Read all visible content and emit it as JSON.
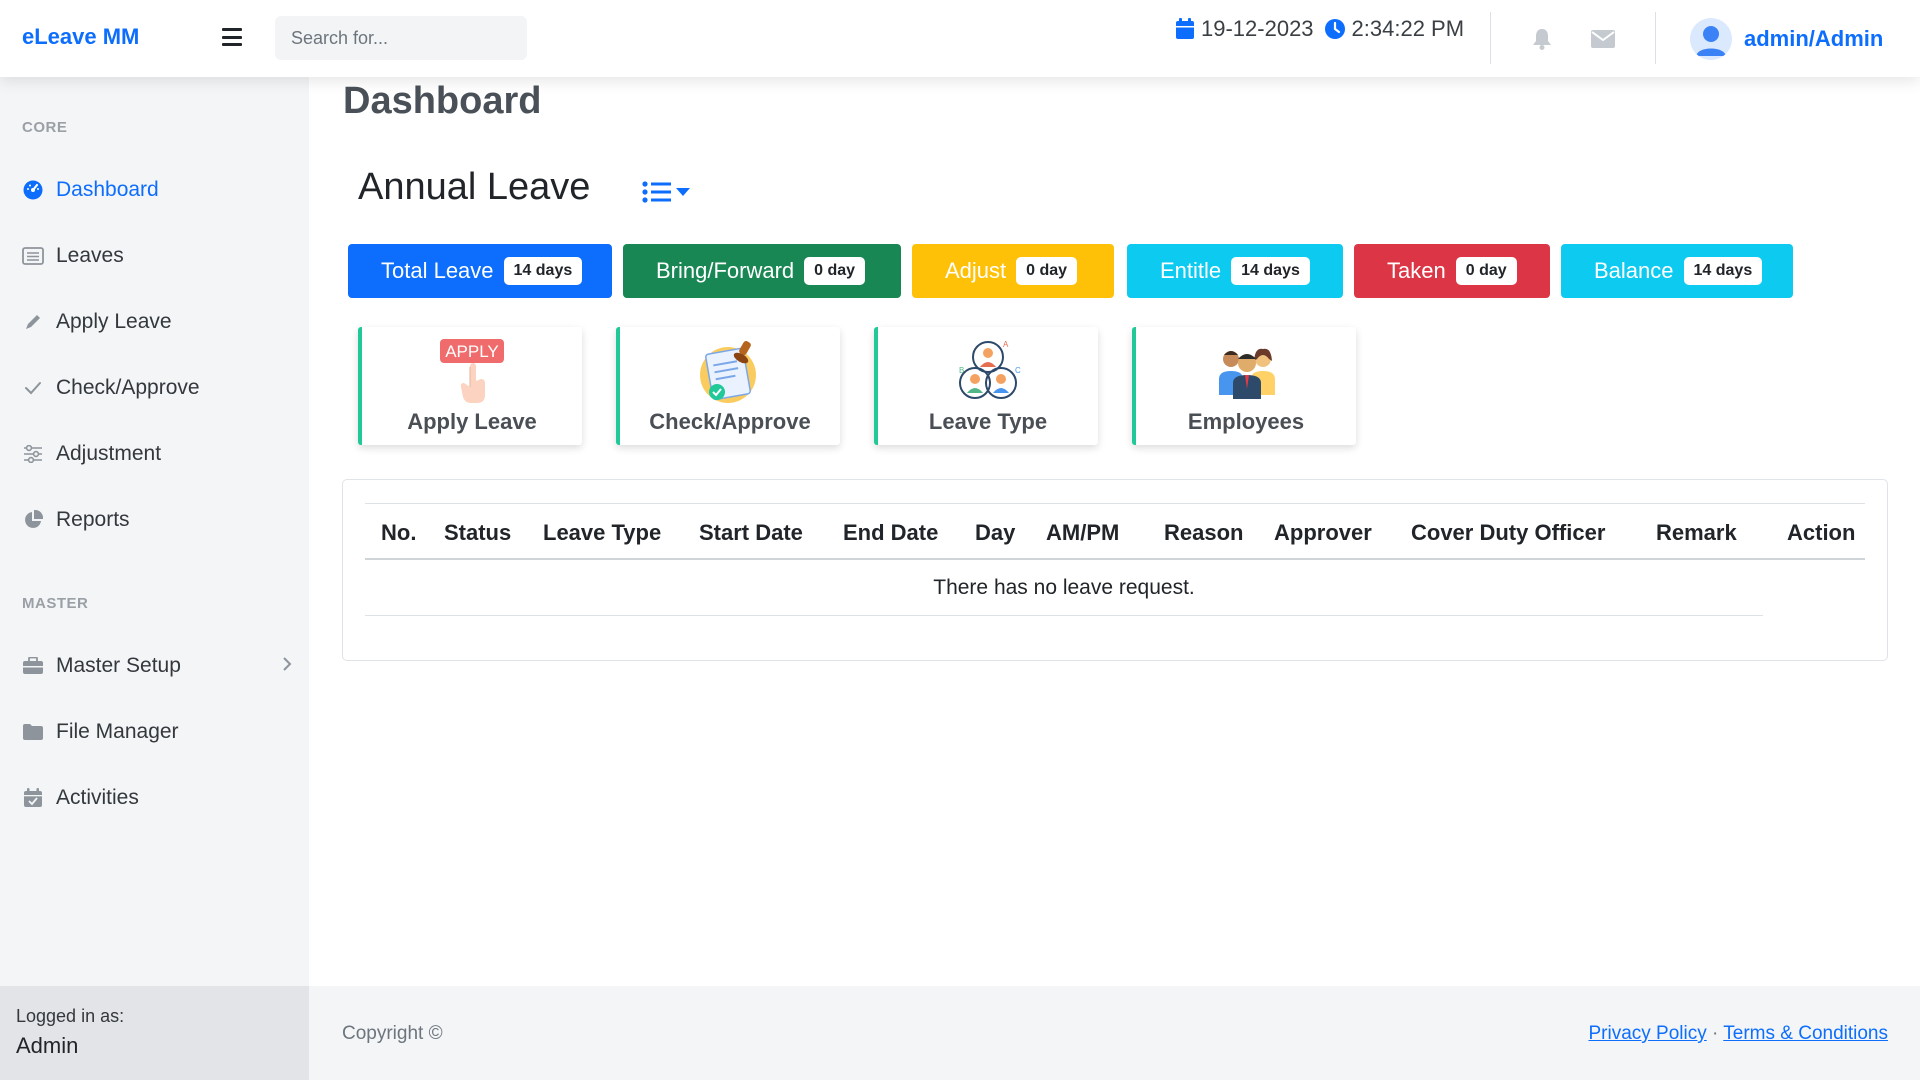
{
  "app": {
    "brand": "eLeave MM"
  },
  "header": {
    "search_placeholder": "Search for...",
    "date": "19-12-2023",
    "time": "2:34:22 PM",
    "user": "admin/Admin"
  },
  "sidebar": {
    "core_heading": "CORE",
    "master_heading": "MASTER",
    "items": [
      {
        "label": "Dashboard",
        "icon": "tachometer-icon",
        "active": true
      },
      {
        "label": "Leaves",
        "icon": "list-icon"
      },
      {
        "label": "Apply Leave",
        "icon": "pen-icon"
      },
      {
        "label": "Check/Approve",
        "icon": "check-icon"
      },
      {
        "label": "Adjustment",
        "icon": "sliders-icon"
      },
      {
        "label": "Reports",
        "icon": "pie-chart-icon"
      }
    ],
    "master_items": [
      {
        "label": "Master Setup",
        "icon": "briefcase-icon"
      },
      {
        "label": "File Manager",
        "icon": "folder-icon"
      },
      {
        "label": "Activities",
        "icon": "calendar-check-icon"
      }
    ],
    "footer_label": "Logged in as:",
    "footer_user": "Admin"
  },
  "main": {
    "page_title": "Dashboard",
    "section_title": "Annual Leave",
    "stats": [
      {
        "label": "Total Leave",
        "value": "14 days",
        "color": "#0d6efd"
      },
      {
        "label": "Bring/Forward",
        "value": "0 day",
        "color": "#198754"
      },
      {
        "label": "Adjust",
        "value": "0 day",
        "color": "#ffc107"
      },
      {
        "label": "Entitle",
        "value": "14 days",
        "color": "#0dcaf0"
      },
      {
        "label": "Taken",
        "value": "0 day",
        "color": "#dc3545"
      },
      {
        "label": "Balance",
        "value": "14 days",
        "color": "#0dcaf0"
      }
    ],
    "quick_links": [
      {
        "label": "Apply Leave",
        "icon": "apply-hand-icon",
        "icon_text": "APPLY"
      },
      {
        "label": "Check/Approve",
        "icon": "document-stamp-icon"
      },
      {
        "label": "Leave Type",
        "icon": "team-network-icon"
      },
      {
        "label": "Employees",
        "icon": "employees-icon"
      }
    ],
    "table": {
      "columns": [
        "No.",
        "Status",
        "Leave Type",
        "Start Date",
        "End Date",
        "Day",
        "AM/PM",
        "Reason",
        "Approver",
        "Cover Duty Officer",
        "Remark",
        "Action"
      ],
      "empty_message": "There has no leave request."
    }
  },
  "footer": {
    "copyright": "Copyright ©",
    "privacy": "Privacy Policy",
    "separator": "·",
    "terms": "Terms & Conditions"
  }
}
